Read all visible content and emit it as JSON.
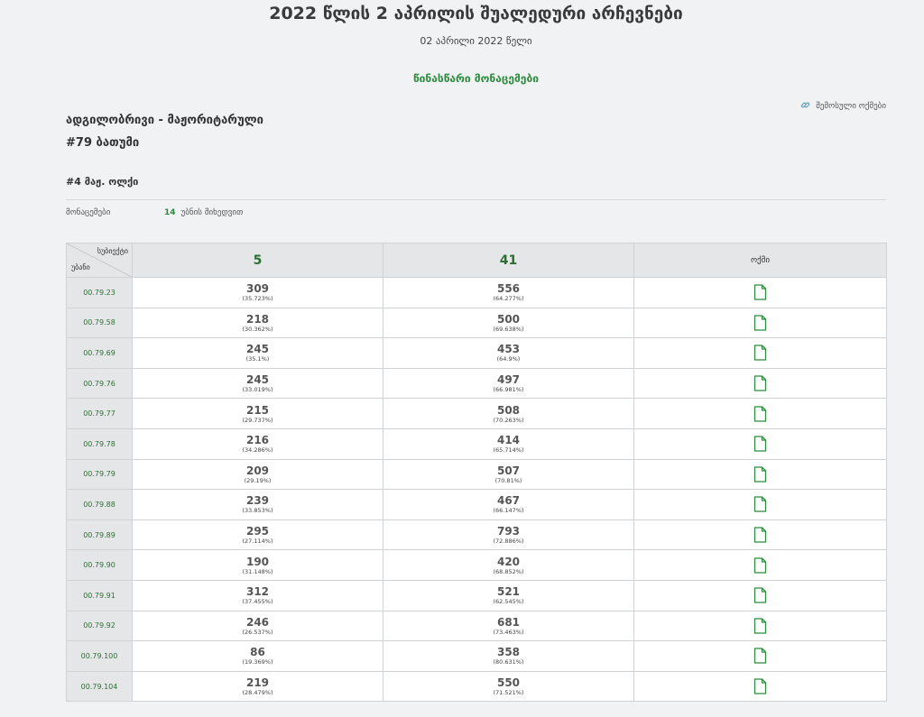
{
  "header": {
    "title": "2022 წლის 2 აპრილის შუალედური არჩევნები",
    "date": "02 აპრილი 2022 წელი",
    "status": "წინასწარი მონაცემები",
    "protocols_link": "შემოსული ოქმები"
  },
  "election": {
    "type": "ადგილობრივი - მაჟორიტარული",
    "district": "#79 ბათუმი",
    "constituency": "#4 მაჟ. ოლქი"
  },
  "info": {
    "label": "მონაცემები",
    "count": "14",
    "suffix": "უბნის მიხედვით"
  },
  "table": {
    "corner_subject": "სუბიექტი",
    "corner_precinct": "უბანი",
    "candidates": [
      "5",
      "41"
    ],
    "protocol_header": "ოქმი",
    "rows": [
      {
        "precinct": "00.79.23",
        "votes": [
          {
            "v": "309",
            "p": "(35.723%)"
          },
          {
            "v": "556",
            "p": "(64.277%)"
          }
        ]
      },
      {
        "precinct": "00.79.58",
        "votes": [
          {
            "v": "218",
            "p": "(30.362%)"
          },
          {
            "v": "500",
            "p": "(69.638%)"
          }
        ]
      },
      {
        "precinct": "00.79.69",
        "votes": [
          {
            "v": "245",
            "p": "(35.1%)"
          },
          {
            "v": "453",
            "p": "(64.9%)"
          }
        ]
      },
      {
        "precinct": "00.79.76",
        "votes": [
          {
            "v": "245",
            "p": "(33.019%)"
          },
          {
            "v": "497",
            "p": "(66.981%)"
          }
        ]
      },
      {
        "precinct": "00.79.77",
        "votes": [
          {
            "v": "215",
            "p": "(29.737%)"
          },
          {
            "v": "508",
            "p": "(70.263%)"
          }
        ]
      },
      {
        "precinct": "00.79.78",
        "votes": [
          {
            "v": "216",
            "p": "(34.286%)"
          },
          {
            "v": "414",
            "p": "(65.714%)"
          }
        ]
      },
      {
        "precinct": "00.79.79",
        "votes": [
          {
            "v": "209",
            "p": "(29.19%)"
          },
          {
            "v": "507",
            "p": "(70.81%)"
          }
        ]
      },
      {
        "precinct": "00.79.88",
        "votes": [
          {
            "v": "239",
            "p": "(33.853%)"
          },
          {
            "v": "467",
            "p": "(66.147%)"
          }
        ]
      },
      {
        "precinct": "00.79.89",
        "votes": [
          {
            "v": "295",
            "p": "(27.114%)"
          },
          {
            "v": "793",
            "p": "(72.886%)"
          }
        ]
      },
      {
        "precinct": "00.79.90",
        "votes": [
          {
            "v": "190",
            "p": "(31.148%)"
          },
          {
            "v": "420",
            "p": "(68.852%)"
          }
        ]
      },
      {
        "precinct": "00.79.91",
        "votes": [
          {
            "v": "312",
            "p": "(37.455%)"
          },
          {
            "v": "521",
            "p": "(62.545%)"
          }
        ]
      },
      {
        "precinct": "00.79.92",
        "votes": [
          {
            "v": "246",
            "p": "(26.537%)"
          },
          {
            "v": "681",
            "p": "(73.463%)"
          }
        ]
      },
      {
        "precinct": "00.79.100",
        "votes": [
          {
            "v": "86",
            "p": "(19.369%)"
          },
          {
            "v": "358",
            "p": "(80.631%)"
          }
        ]
      },
      {
        "precinct": "00.79.104",
        "votes": [
          {
            "v": "219",
            "p": "(28.479%)"
          },
          {
            "v": "550",
            "p": "(71.521%)"
          }
        ]
      }
    ]
  },
  "colors": {
    "accent_green": "#2e8b3e",
    "dark_green": "#2e6e33",
    "background": "#f0f2f4",
    "header_gray": "#e4e6e8"
  },
  "icons": {
    "protocols_link": "link-icon",
    "protocol_doc": "document-icon"
  }
}
